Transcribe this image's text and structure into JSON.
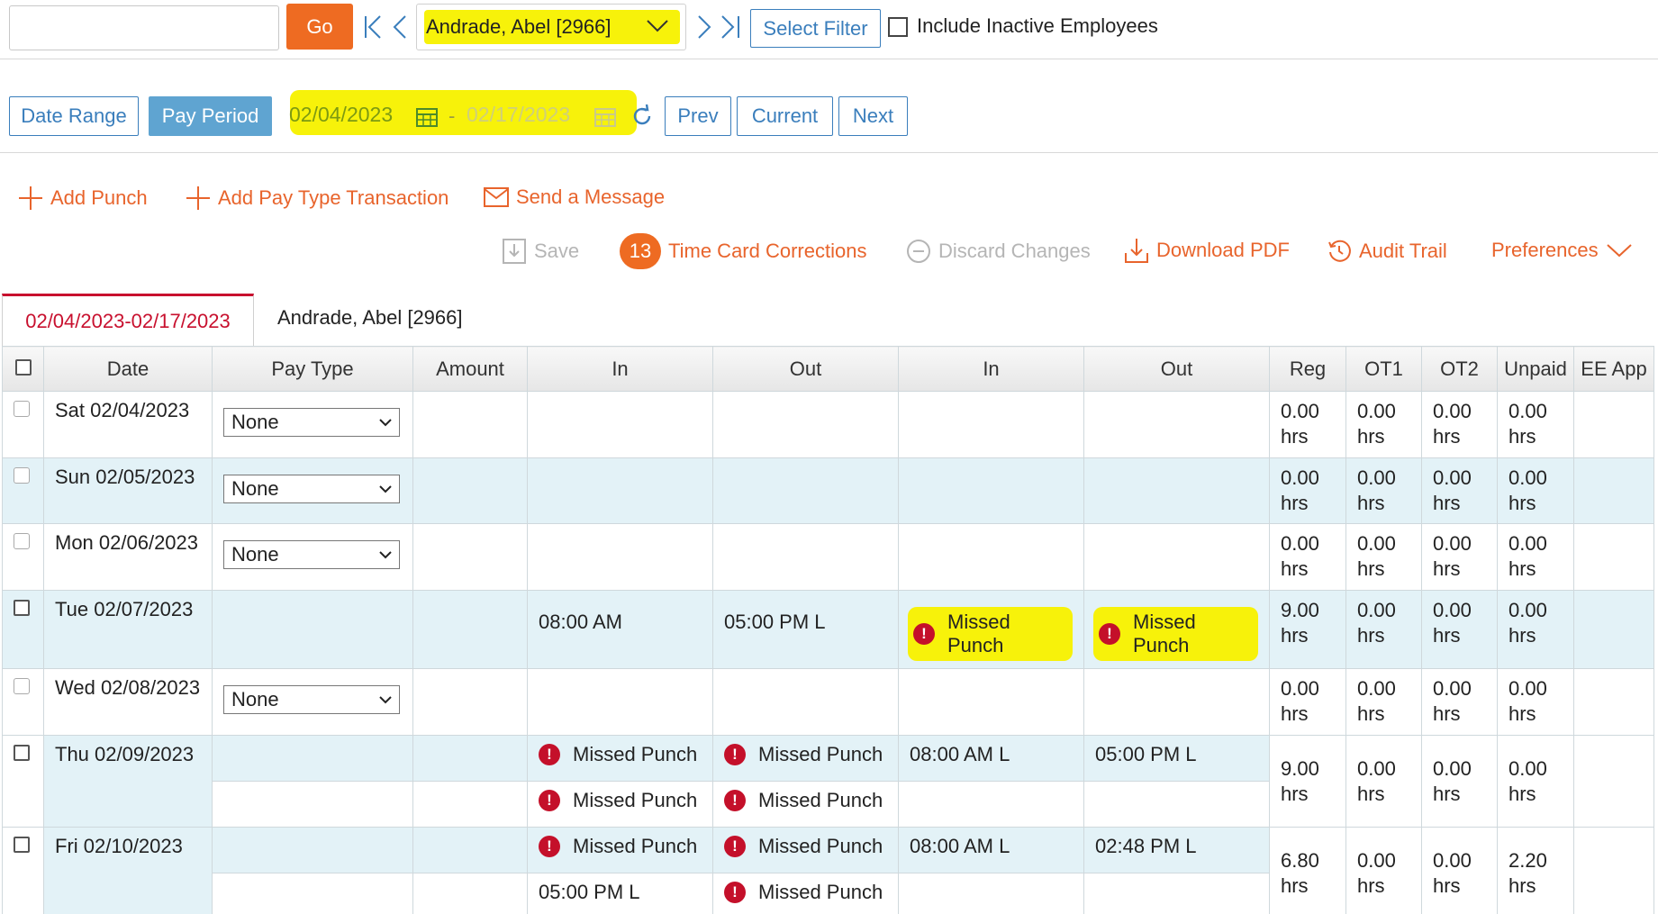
{
  "topbar": {
    "go_label": "Go",
    "employee": "Andrade, Abel [2966]",
    "select_filter": "Select Filter",
    "include_inactive": "Include Inactive Employees"
  },
  "period": {
    "date_range": "Date Range",
    "pay_period": "Pay Period",
    "from": "02/04/2023",
    "dash": "-",
    "to": "02/17/2023",
    "prev": "Prev",
    "current": "Current",
    "next": "Next"
  },
  "actions": {
    "add_punch": "Add Punch",
    "add_pay_type": "Add Pay Type Transaction",
    "send_message": "Send a Message",
    "save": "Save",
    "corrections_count": "13",
    "corrections": "Time Card Corrections",
    "discard": "Discard Changes",
    "download_pdf": "Download PDF",
    "audit_trail": "Audit Trail",
    "preferences": "Preferences"
  },
  "tabs": {
    "period": "02/04/2023-02/17/2023",
    "employee": "Andrade, Abel [2966]"
  },
  "table": {
    "headers": [
      "Date",
      "Pay Type",
      "Amount",
      "In",
      "Out",
      "In",
      "Out",
      "Reg",
      "OT1",
      "OT2",
      "Unpaid",
      "EE App"
    ],
    "rows": [
      {
        "date": "Sat 02/04/2023",
        "paytype": "None",
        "reg": "0.00",
        "ot1": "0.00",
        "ot2": "0.00",
        "unpaid": "0.00"
      },
      {
        "date": "Sun 02/05/2023",
        "paytype": "None",
        "reg": "0.00",
        "ot1": "0.00",
        "ot2": "0.00",
        "unpaid": "0.00"
      },
      {
        "date": "Mon 02/06/2023",
        "paytype": "None",
        "reg": "0.00",
        "ot1": "0.00",
        "ot2": "0.00",
        "unpaid": "0.00"
      },
      {
        "date": "Tue 02/07/2023",
        "in1": "08:00 AM",
        "out1": "05:00 PM  L",
        "in2": "Missed Punch",
        "out2": "Missed Punch",
        "reg": "9.00",
        "ot1": "0.00",
        "ot2": "0.00",
        "unpaid": "0.00"
      },
      {
        "date": "Wed 02/08/2023",
        "paytype": "None",
        "reg": "0.00",
        "ot1": "0.00",
        "ot2": "0.00",
        "unpaid": "0.00"
      },
      {
        "date": "Thu 02/09/2023",
        "in1": "Missed Punch",
        "out1": "Missed Punch",
        "in2": "08:00 AM  L",
        "out2": "05:00 PM  L",
        "in1b": "Missed Punch",
        "out1b": "Missed Punch",
        "reg": "9.00",
        "ot1": "0.00",
        "ot2": "0.00",
        "unpaid": "0.00"
      },
      {
        "date": "Fri 02/10/2023",
        "in1": "Missed Punch",
        "out1": "Missed Punch",
        "in2": "08:00 AM  L",
        "out2": "02:48 PM  L",
        "in1b": "05:00 PM  L",
        "out1b": "Missed Punch",
        "reg": "6.80",
        "ot1": "0.00",
        "ot2": "0.00",
        "unpaid": "2.20"
      }
    ],
    "unit": "hrs"
  },
  "colors": {
    "accent_orange": "#ee6b22",
    "link_blue": "#3a7ebc",
    "highlight_yellow": "#f7f20a",
    "row_blue": "#e3f2f7",
    "error_red": "#c4102a"
  }
}
